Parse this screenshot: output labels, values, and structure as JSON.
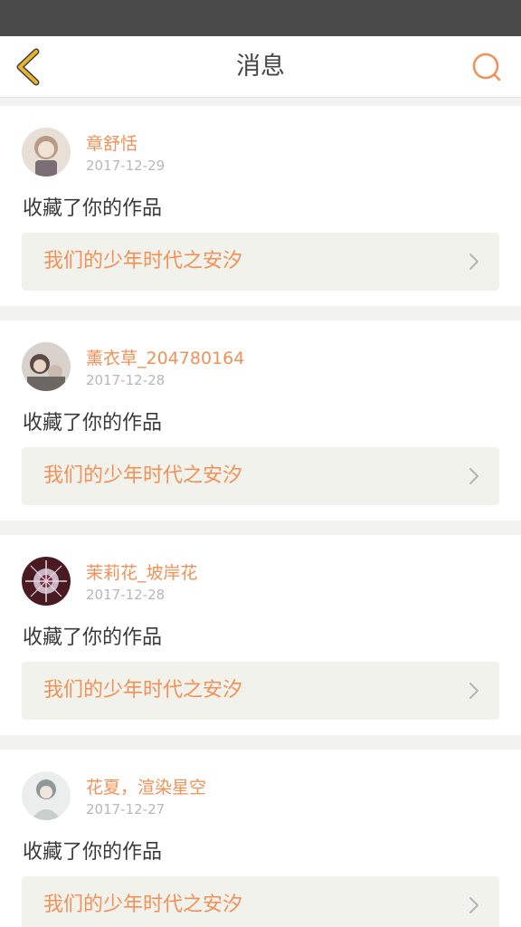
{
  "header": {
    "title": "消息"
  },
  "messages": [
    {
      "user": "章舒恬",
      "date": "2017-12-29",
      "action": "收藏了你的作品",
      "work_title": "我们的少年时代之安汐",
      "avatar_colors": [
        "#e8dfd6",
        "#b79b86"
      ]
    },
    {
      "user": "薰衣草_204780164",
      "date": "2017-12-28",
      "action": "收藏了你的作品",
      "work_title": "我们的少年时代之安汐",
      "avatar_colors": [
        "#d9d2cc",
        "#5a4a42"
      ]
    },
    {
      "user": "茉莉花_坡岸花",
      "date": "2017-12-28",
      "action": "收藏了你的作品",
      "work_title": "我们的少年时代之安汐",
      "avatar_colors": [
        "#4a1a22",
        "#c8b6c2"
      ]
    },
    {
      "user": "花夏，渲染星空",
      "date": "2017-12-27",
      "action": "收藏了你的作品",
      "work_title": "我们的少年时代之安汐",
      "avatar_colors": [
        "#eceeee",
        "#8e9a97"
      ]
    }
  ],
  "colors": {
    "accent": "#f09157",
    "back_icon": "#e6b22f",
    "status_bar": "#4a4a4a"
  }
}
